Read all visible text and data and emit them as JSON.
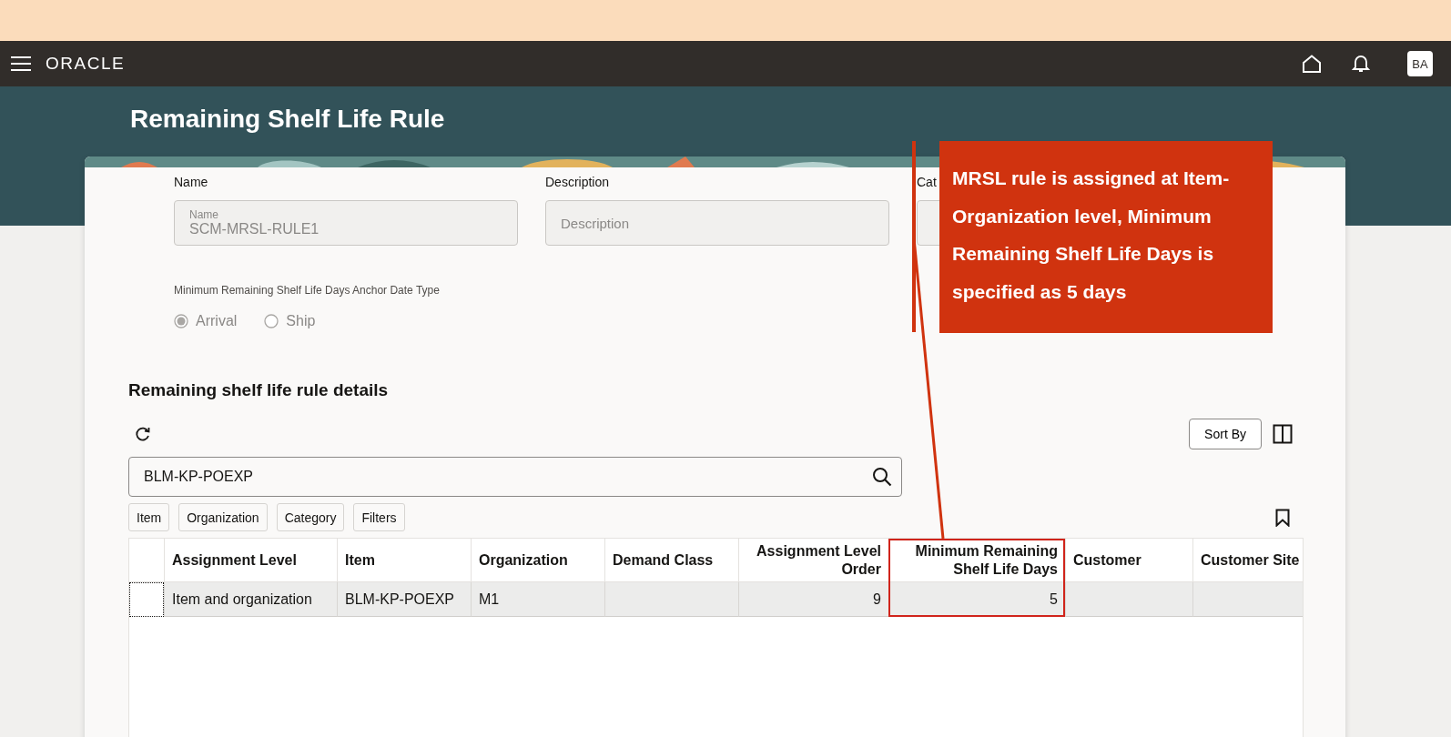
{
  "top_bar": {
    "logo": "ORACLE",
    "avatar": "BA"
  },
  "page_title": "Remaining Shelf Life Rule",
  "form": {
    "fields": [
      {
        "label": "Name",
        "floating_label": "Name",
        "value": "SCM-MRSL-RULE1",
        "disabled": true
      },
      {
        "label": "Description",
        "placeholder": "Description",
        "disabled": true
      },
      {
        "label": "Cat",
        "disabled": true
      }
    ],
    "anchor_date_type": {
      "label": "Minimum Remaining Shelf Life Days Anchor Date Type",
      "disabled": true,
      "options": [
        {
          "label": "Arrival",
          "selected": true
        },
        {
          "label": "Ship",
          "selected": false
        }
      ]
    }
  },
  "details": {
    "title": "Remaining shelf life rule details",
    "sort_button": "Sort By",
    "search": {
      "value": "BLM-KP-POEXP"
    },
    "filter_chips": [
      "Item",
      "Organization",
      "Category",
      "Filters"
    ],
    "table": {
      "columns": [
        {
          "label": "Assignment Level",
          "kind": "text",
          "highlighted": false
        },
        {
          "label": "Item",
          "kind": "text",
          "highlighted": false
        },
        {
          "label": "Organization",
          "kind": "text",
          "highlighted": false
        },
        {
          "label": "Demand Class",
          "kind": "text",
          "highlighted": false
        },
        {
          "label": "Assignment Level Order",
          "kind": "number",
          "highlighted": false
        },
        {
          "label": "Minimum Remaining Shelf Life Days",
          "kind": "number",
          "highlighted": true
        },
        {
          "label": "Customer",
          "kind": "text",
          "highlighted": false
        },
        {
          "label": "Customer Site",
          "kind": "text",
          "highlighted": false
        }
      ],
      "rows": [
        {
          "cells": [
            "Item and organization",
            "BLM-KP-POEXP",
            "M1",
            "",
            "9",
            "5",
            "",
            ""
          ]
        }
      ]
    }
  },
  "callout": {
    "text": "MRSL rule is assigned at Item-Organization level, Minimum Remaining Shelf Life Days is specified as 5 days"
  }
}
